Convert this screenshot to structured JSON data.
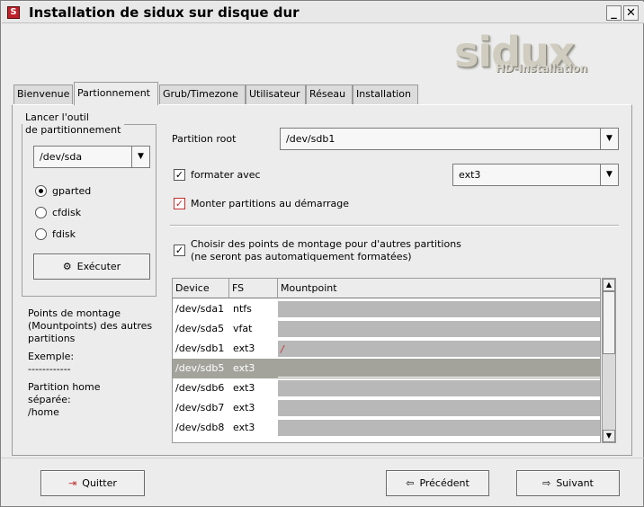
{
  "window": {
    "title": "Installation de sidux sur disque dur",
    "icon_letter": "S",
    "minimize_glyph": "_",
    "close_glyph": "✕"
  },
  "logo": {
    "main": "sidux",
    "sub": "HD-Installation"
  },
  "tabs": [
    {
      "label": "Bienvenue",
      "active": false
    },
    {
      "label": "Partionnement",
      "active": true
    },
    {
      "label": "Grub/Timezone",
      "active": false
    },
    {
      "label": "Utilisateur",
      "active": false
    },
    {
      "label": "Réseau",
      "active": false
    },
    {
      "label": "Installation",
      "active": false
    }
  ],
  "tool_group": {
    "title_line1": "Lancer l'outil",
    "title_line2": "de partitionnement",
    "device": "/dev/sda",
    "options": [
      {
        "label": "gparted",
        "selected": true
      },
      {
        "label": "cfdisk",
        "selected": false
      },
      {
        "label": "fdisk",
        "selected": false
      }
    ],
    "execute_label": "Exécuter"
  },
  "info": {
    "line1": "Points de montage",
    "line2": "(Mountpoints) des autres",
    "line3": "partitions",
    "example_label": "Exemple:",
    "dashes": "------------",
    "line4": "Partition home",
    "line5": "séparée:",
    "line6": "/home"
  },
  "root": {
    "label": "Partition root",
    "value": "/dev/sdb1",
    "format_label": "formater avec",
    "format_checked": true,
    "fs": "ext3",
    "mount_label": "Monter partitions au démarrage",
    "mount_checked": true
  },
  "mountpoints": {
    "choose_label_line1": "Choisir des points de montage pour d'autres partitions",
    "choose_label_line2": "(ne seront pas automatiquement formatées)",
    "choose_checked": true,
    "columns": [
      "Device",
      "FS",
      "Mountpoint"
    ],
    "rows": [
      {
        "device": "/dev/sda1",
        "fs": "ntfs",
        "mountpoint": "",
        "selected": false
      },
      {
        "device": "/dev/sda5",
        "fs": "vfat",
        "mountpoint": "",
        "selected": false
      },
      {
        "device": "/dev/sdb1",
        "fs": "ext3",
        "mountpoint": "/",
        "selected": false
      },
      {
        "device": "/dev/sdb5",
        "fs": "ext3",
        "mountpoint": "",
        "selected": true
      },
      {
        "device": "/dev/sdb6",
        "fs": "ext3",
        "mountpoint": "",
        "selected": false
      },
      {
        "device": "/dev/sdb7",
        "fs": "ext3",
        "mountpoint": "",
        "selected": false
      },
      {
        "device": "/dev/sdb8",
        "fs": "ext3",
        "mountpoint": "",
        "selected": false
      }
    ]
  },
  "buttons": {
    "quit": "Quitter",
    "previous": "Précédent",
    "next": "Suivant"
  },
  "colors": {
    "close_mark": "#c03030",
    "selection": "#a3a39c"
  }
}
